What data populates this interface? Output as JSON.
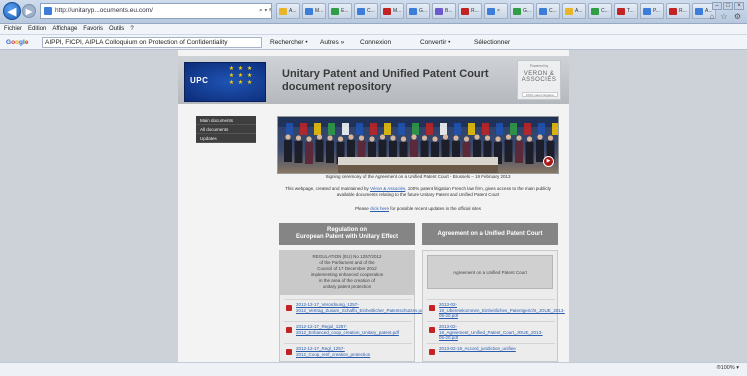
{
  "browser": {
    "address": "http://unitaryp...ocuments.eu.com/",
    "address_icons": "⌕ ▾ ≡ ↻",
    "tabs": [
      {
        "label": "A...",
        "color": "#e8b528"
      },
      {
        "label": "M...",
        "color": "#3b7dd8"
      },
      {
        "label": "E...",
        "color": "#2f9e44"
      },
      {
        "label": "C...",
        "color": "#3b7dd8"
      },
      {
        "label": "M...",
        "color": "#c42323"
      },
      {
        "label": "G...",
        "color": "#3b7dd8"
      },
      {
        "label": "B...",
        "color": "#6a5acd"
      },
      {
        "label": "R...",
        "color": "#c42323"
      },
      {
        "label": "×",
        "color": "#3b7dd8"
      },
      {
        "label": "G...",
        "color": "#2f9e44"
      },
      {
        "label": "C...",
        "color": "#3b7dd8"
      },
      {
        "label": "A...",
        "color": "#e8b528"
      },
      {
        "label": "C...",
        "color": "#2f9e44"
      },
      {
        "label": "T...",
        "color": "#c42323"
      },
      {
        "label": "P...",
        "color": "#3b7dd8"
      },
      {
        "label": "R...",
        "color": "#c42323"
      },
      {
        "label": "A...",
        "color": "#3b7dd8"
      }
    ],
    "window_controls": [
      "–",
      "□",
      "×"
    ],
    "toolbar_icons": "⌂ ☆ ⚙",
    "menu": [
      "Fichier",
      "Edition",
      "Affichage",
      "Favoris",
      "Outils",
      "?"
    ],
    "google": {
      "logo": [
        "G",
        "o",
        "o",
        "g",
        "l",
        "e"
      ],
      "search_value": "AIPPI, FICPI, AIPLA Colloquium on Protection of Confidentiality",
      "rechercher": "Rechercher •",
      "autres": "Autres »",
      "connexion": "Connexion",
      "convertir": "Convertir •",
      "selectionner": "Sélectionner"
    },
    "zoom": "®100% ▾"
  },
  "page": {
    "logo_text": "UPC",
    "logo_stars": "★ ★ ★\n★ ★ ★\n★ ★ ★",
    "title": "Unitary Patent and Unified Patent Court document repository",
    "partner": {
      "powered": "Powered by",
      "name": "VERON & ASSOCIÉS",
      "tagline": "100% patent litigation"
    },
    "nav": [
      "Main documents",
      "All documents",
      "Updates"
    ],
    "caption": "Signing ceremony of the Agreement on a Unified Patent Court - Brussels – 19 February 2013",
    "intro_prefix": "This webpage, created and maintained by",
    "intro_link": "Véron & Associés",
    "intro_suffix": ", 100% patent litigation French law firm, gives access to the main publicly available documents relating to the future Unitary Patent and Unified Patent Court",
    "please_prefix": "Please",
    "please_link": "click here",
    "please_suffix": "for possible recent updates in the official sites",
    "left_column": {
      "button": "Regulation on\nEuropean Patent with Unitary Effect",
      "head": "REGULATION (EU) No 1257/2012\nof the Parliament and of the\nCouncil of 17 December 2012\nimplementing enhanced cooperation\nin the area of the creation of\nunitary patent protection",
      "docs": [
        "2012-12-17_Verordnung_1257-2012_Vertrag_Zusam_Schaffu_Einheitlicher_Patentschutzes.pdf",
        "2012-12-17_Regul_1257-2012_Enhanced_coop_creation_Unitary_patent.pdf",
        "2012-12-17_Regl_1257-2012_Coop_renf_creation_protection"
      ]
    },
    "right_column": {
      "button": "Agreement on a Unified Patent Court",
      "head": "Agreement on a Unified Patent Court",
      "docs": [
        "2013-02-19_Ubereinkommen_Einheitliches_Patentgericht_JOUE_2013-06-20.pdf",
        "2013-02-19_Agreement_Unified_Patent_Court_JOUE_2013-06-20.pdf",
        "2013-02-19_Accord_juridiction_unifiee"
      ]
    }
  }
}
